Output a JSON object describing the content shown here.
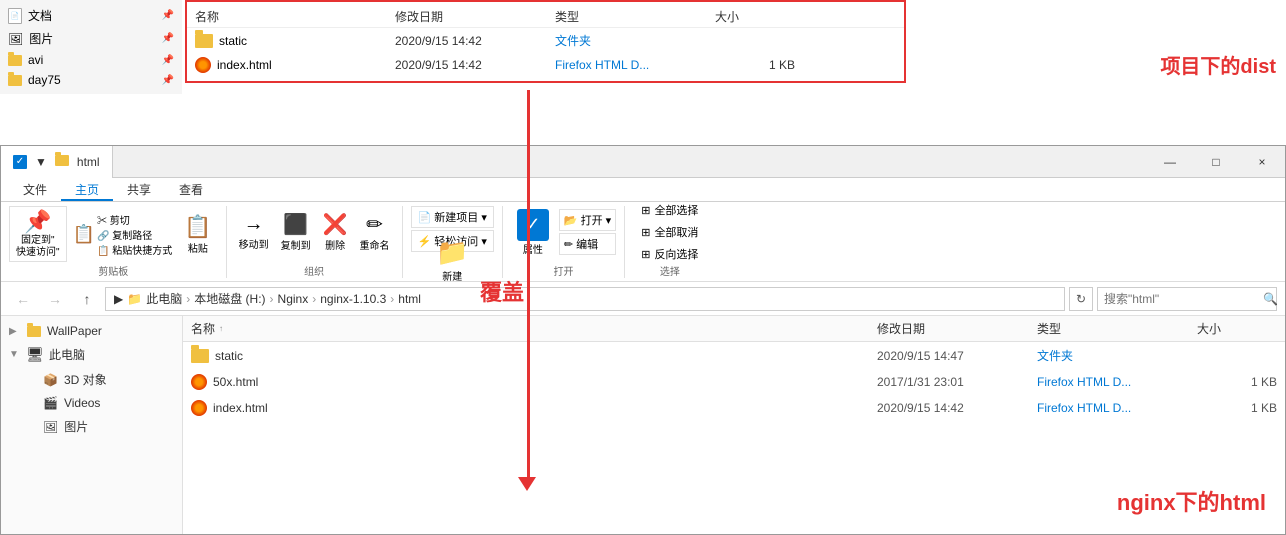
{
  "topOverlay": {
    "navItems": [
      {
        "label": "文档",
        "icon": "doc"
      },
      {
        "label": "图片",
        "icon": "pic"
      },
      {
        "label": "avi",
        "icon": "folder"
      },
      {
        "label": "day75",
        "icon": "folder"
      }
    ],
    "tableHeader": {
      "name": "名称",
      "date": "修改日期",
      "type": "类型",
      "size": "大小"
    },
    "files": [
      {
        "name": "static",
        "type": "folder",
        "date": "2020/9/15 14:42",
        "fileType": "文件夹",
        "size": ""
      },
      {
        "name": "index.html",
        "type": "html",
        "date": "2020/9/15 14:42",
        "fileType": "Firefox HTML D...",
        "size": "1 KB"
      }
    ],
    "annotation": "项目下的dist"
  },
  "titleBar": {
    "tabLabel": "html",
    "checkboxLabel": "✓",
    "breadcrumb": [
      "此电脑",
      "本地磁盘 (H:)",
      "Nginx",
      "nginx-1.10.3",
      "html"
    ],
    "searchPlaceholder": "搜索\"html\"",
    "windowControls": [
      "—",
      "□",
      "×"
    ]
  },
  "ribbonTabs": [
    "文件",
    "主页",
    "共享",
    "查看"
  ],
  "ribbonSections": {
    "clipboard": {
      "label": "剪贴板",
      "buttons": [
        {
          "icon": "📌",
          "label": "固定到\"\n快速访问\""
        },
        {
          "icon": "📋",
          "label": "复制"
        },
        {
          "icon": "📌",
          "label": "粘贴"
        }
      ],
      "smallButtons": [
        "✂ 剪切",
        "⬜ 复制路径",
        "📋 粘贴快捷方式"
      ]
    },
    "organize": {
      "label": "组织",
      "buttons": [
        {
          "icon": "→",
          "label": "移动到"
        },
        {
          "icon": "⬛",
          "label": "复制到"
        },
        {
          "icon": "🗑",
          "label": "删除"
        },
        {
          "icon": "✏",
          "label": "重命名"
        }
      ]
    },
    "new": {
      "label": "新建",
      "buttons": [
        {
          "icon": "📁",
          "label": "新建\n文件夹"
        }
      ],
      "dropdowns": [
        "📄 新建项目▾",
        "⚡ 轻松访问▾"
      ]
    },
    "open": {
      "label": "打开",
      "buttons": [
        {
          "icon": "✓",
          "label": "属性"
        }
      ],
      "dropdowns": [
        "📂 打开▾",
        "✏ 编辑"
      ]
    },
    "select": {
      "label": "选择",
      "buttons": [
        {
          "label": "全部选择"
        },
        {
          "label": "全部取消"
        },
        {
          "label": "反向选择"
        }
      ]
    }
  },
  "sidebar": {
    "items": [
      {
        "label": "WallPaper",
        "icon": "folder",
        "level": 0
      },
      {
        "label": "此电脑",
        "icon": "pc",
        "level": 0
      },
      {
        "label": "3D 对象",
        "icon": "folder3d",
        "level": 1
      },
      {
        "label": "Videos",
        "icon": "video",
        "level": 1
      },
      {
        "label": "图片",
        "icon": "pic",
        "level": 1
      }
    ]
  },
  "fileList": {
    "header": {
      "name": "名称",
      "sortArrow": "↑",
      "date": "修改日期",
      "type": "类型",
      "size": "大小"
    },
    "files": [
      {
        "name": "static",
        "type": "folder",
        "date": "2020/9/15 14:47",
        "fileType": "文件夹",
        "size": ""
      },
      {
        "name": "50x.html",
        "type": "html",
        "date": "2017/1/31 23:01",
        "fileType": "Firefox HTML D...",
        "size": "1 KB"
      },
      {
        "name": "index.html",
        "type": "html",
        "date": "2020/9/15 14:42",
        "fileType": "Firefox HTML D...",
        "size": "1 KB"
      }
    ]
  },
  "annotations": {
    "cover": "覆盖",
    "nginxHtml": "nginx下的html"
  }
}
